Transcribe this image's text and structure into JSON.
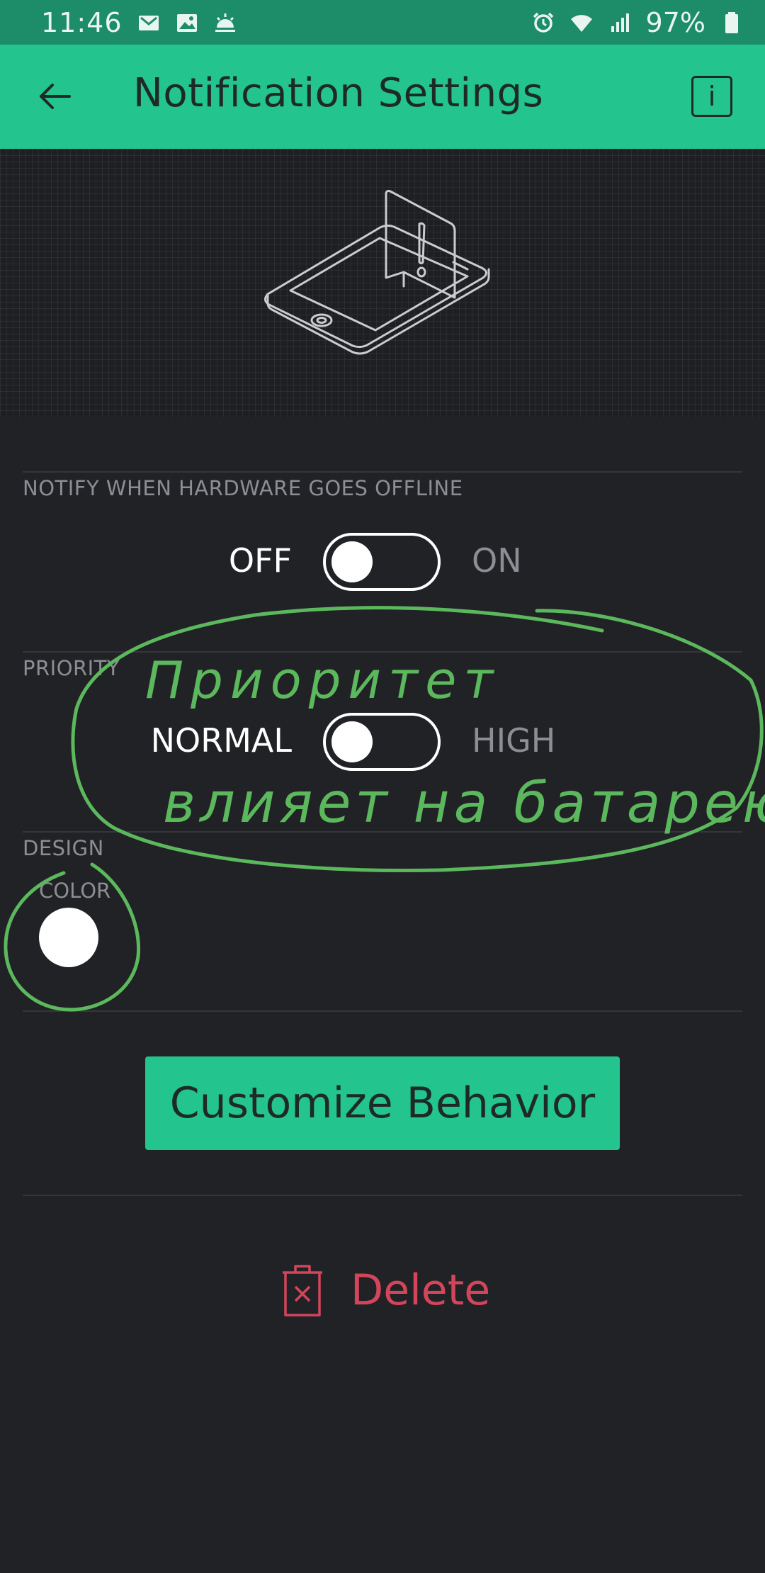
{
  "status_bar": {
    "time": "11:46",
    "battery_percent": "97%",
    "icons_left": [
      "gmail-icon",
      "gallery-icon",
      "weather-icon"
    ],
    "icons_right": [
      "alarm-icon",
      "wifi-icon",
      "signal-icon",
      "battery-icon"
    ]
  },
  "app_bar": {
    "title": "Notification Settings",
    "back_icon": "arrow-left-icon",
    "info_label": "i"
  },
  "sections": {
    "offline": {
      "label": "NOTIFY WHEN HARDWARE GOES OFFLINE",
      "off_label": "OFF",
      "on_label": "ON",
      "state": "off"
    },
    "priority": {
      "label": "PRIORITY",
      "off_label": "NORMAL",
      "on_label": "HIGH",
      "state": "off"
    },
    "design": {
      "label": "DESIGN",
      "color_label": "COLOR",
      "color_value": "#ffffff"
    }
  },
  "actions": {
    "customize_label": "Customize Behavior",
    "delete_label": "Delete"
  },
  "annotation": {
    "line1": "Приоритет",
    "line2": "влияет на батарею",
    "color": "#5cb85c"
  },
  "colors": {
    "accent": "#23c48e",
    "status_bar": "#1d8c69",
    "background": "#212226",
    "danger": "#d3455b"
  }
}
